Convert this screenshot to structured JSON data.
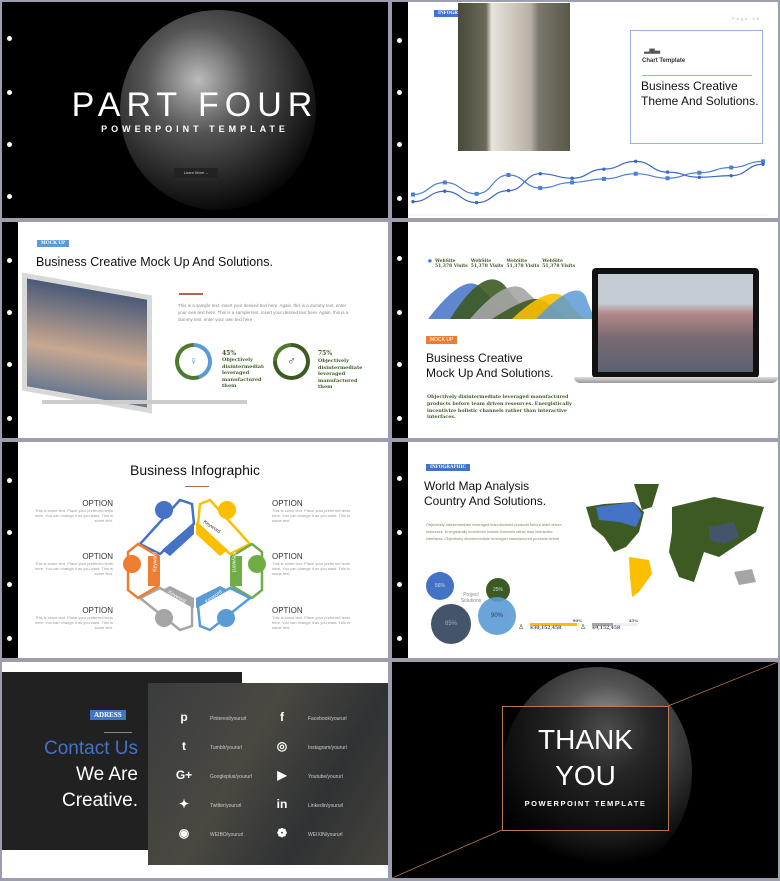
{
  "colors": {
    "blue": "#3f74cc",
    "green": "#3d5a23",
    "orange": "#ed7d31",
    "yellow": "#fbbf00",
    "gray": "#a5a5a5",
    "copper": "#b87a56",
    "navy": "#44546a"
  },
  "slide1": {
    "title": "PART FOUR",
    "subtitle": "POWERPOINT TEMPLATE",
    "button": "Learn More→"
  },
  "slide2": {
    "tag": "INFOGRAPHIC",
    "page": "Page 25",
    "box_label": "Chart Template",
    "box_icon": "bar-chart-icon",
    "heading": "Business Creative Theme And Solutions."
  },
  "chart_data": {
    "type": "line",
    "smooth": true,
    "axes": false,
    "series": [
      {
        "marker": "square",
        "values": [
          3.0,
          4.85,
          3.1,
          6.0,
          4.0,
          4.85,
          5.4,
          6.2,
          5.5,
          6.35,
          7.15,
          8.1
        ]
      },
      {
        "marker": "circle",
        "values": [
          1.9,
          3.5,
          1.75,
          3.6,
          6.2,
          5.5,
          6.9,
          8.1,
          6.45,
          5.65,
          5.9,
          7.65
        ]
      }
    ]
  },
  "slide3": {
    "tag": "MOCK UP",
    "title": "Business Creative  Mock Up And Solutions.",
    "paragraph": "This is a sample text. insert your desired text here. Again. this is a dummy text. enter your own text here. This is a sample text. insert your desired text here. Again. this is a dummy text. enter your own text here .",
    "stats": [
      {
        "value": "45%",
        "percent": 45,
        "text": "Objectively disintermediate leveraged manufactured them",
        "icon": "female-icon"
      },
      {
        "value": "75%",
        "percent": 75,
        "text": "Objectively disintermediate leveraged manufactured them",
        "icon": "male-icon"
      }
    ]
  },
  "slide4": {
    "legend": [
      {
        "label": "WebSite",
        "value": "51,378 Visits"
      },
      {
        "label": "WebSite",
        "value": "51,378 Visits"
      },
      {
        "label": "WebSite",
        "value": "51,378 Visits"
      },
      {
        "label": "WebSite",
        "value": "51,378 Visits"
      }
    ],
    "tag": "MOCK UP",
    "title_line1": "Business Creative",
    "title_line2": "Mock Up And Solutions.",
    "paragraph": "Objectively disintermediate leveraged manufactured products before team driven resources. Energistically incentivize holistic channels rather than interactive interfaces."
  },
  "slide5": {
    "title": "Business Infographic",
    "segment_label": "Keyword",
    "options": [
      {
        "title": "OPTION",
        "text": "This is some text. Place your preferred texts here. You can change it as you want. This is some text."
      },
      {
        "title": "OPTION",
        "text": "This is some text. Place your preferred texts here. You can change it as you want. This is some text."
      },
      {
        "title": "OPTION",
        "text": "This is some text. Place your preferred texts here. You can change it as you want. This is some text."
      },
      {
        "title": "OPTION",
        "text": "This is some text. Place your preferred texts here. You can change it as you want. This is some text."
      },
      {
        "title": "OPTION",
        "text": "This is some text. Place your preferred texts here. You can change it as you want. This is some text."
      },
      {
        "title": "OPTION",
        "text": "This is some text. Place your preferred texts here. You can change it as you want. This is some text."
      }
    ]
  },
  "slide6": {
    "tag": "INFOGRAPHIC",
    "title_line1": "World Map Analysis",
    "title_line2": "Country And Solutions.",
    "paragraph": "Objectively disintermediate leveraged manufactured products before team driven resources. Energistically incentivize holistic channels rather than interactive interfaces. Objectively disintermediate leveraged manufactured products before",
    "bubbles": [
      {
        "label": "56%"
      },
      {
        "label": "25%"
      },
      {
        "label": "85%"
      },
      {
        "label": "90%"
      }
    ],
    "center_label": "Project Solutions",
    "progress": [
      {
        "percent": 90,
        "label": "90%",
        "amount": "$30,152,458"
      },
      {
        "percent": 45,
        "label": "45%",
        "amount": "$9,152,458"
      }
    ]
  },
  "slide7": {
    "tag": "ADRESS",
    "line1": "Contact Us",
    "line2": "We Are",
    "line3": "Creative.",
    "social": [
      {
        "icon": "pinterest-icon",
        "glyph": "p",
        "label": "Pinterest/yoururl"
      },
      {
        "icon": "facebook-icon",
        "glyph": "f",
        "label": "Facebook/yoururl"
      },
      {
        "icon": "tumblr-icon",
        "glyph": "t",
        "label": "Tumblr/yoururl"
      },
      {
        "icon": "instagram-icon",
        "glyph": "◎",
        "label": "Instagram/yoururl"
      },
      {
        "icon": "googleplus-icon",
        "glyph": "G+",
        "label": "Googleplus/yoururl"
      },
      {
        "icon": "youtube-icon",
        "glyph": "▶",
        "label": "Youtube/yoururl"
      },
      {
        "icon": "twitter-icon",
        "glyph": "✦",
        "label": "Twitter/yoururl"
      },
      {
        "icon": "linkedin-icon",
        "glyph": "in",
        "label": "Linkedin/yoururl"
      },
      {
        "icon": "weibo-icon",
        "glyph": "◉",
        "label": "WEIBO/yoururl"
      },
      {
        "icon": "wechat-icon",
        "glyph": "❁",
        "label": "WEIXIN/yoururl"
      }
    ]
  },
  "slide8": {
    "line1": "THANK",
    "line2": "YOU",
    "subtitle": "POWERPOINT TEMPLATE"
  }
}
